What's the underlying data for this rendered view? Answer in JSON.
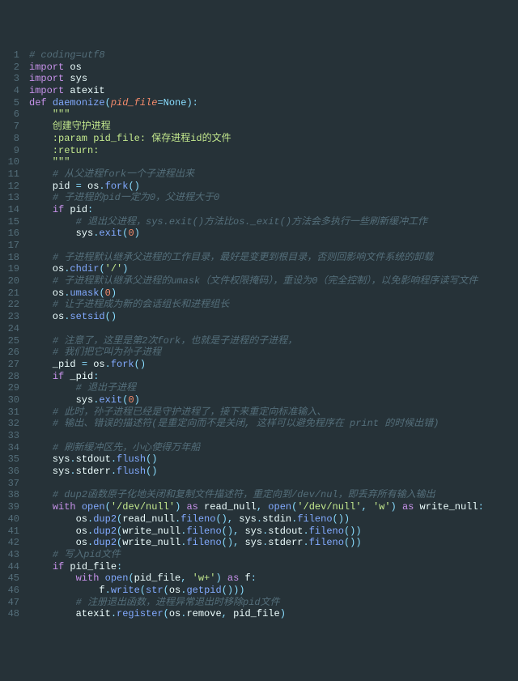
{
  "lines": [
    {
      "n": 1,
      "tokens": [
        [
          "com",
          "# coding=utf8"
        ]
      ]
    },
    {
      "n": 2,
      "tokens": [
        [
          "kw",
          "import"
        ],
        [
          "var",
          " os"
        ]
      ]
    },
    {
      "n": 3,
      "tokens": [
        [
          "kw",
          "import"
        ],
        [
          "var",
          " sys"
        ]
      ]
    },
    {
      "n": 4,
      "tokens": [
        [
          "kw",
          "import"
        ],
        [
          "var",
          " atexit"
        ]
      ]
    },
    {
      "n": 5,
      "tokens": [
        [
          "kw",
          "def "
        ],
        [
          "fn",
          "daemonize"
        ],
        [
          "op",
          "("
        ],
        [
          "param",
          "pid_file"
        ],
        [
          "op",
          "="
        ],
        [
          "kw2",
          "None"
        ],
        [
          "op",
          "):"
        ]
      ]
    },
    {
      "n": 6,
      "tokens": [
        [
          "var",
          "    "
        ],
        [
          "str",
          "\"\"\""
        ]
      ]
    },
    {
      "n": 7,
      "tokens": [
        [
          "str",
          "    创建守护进程"
        ]
      ]
    },
    {
      "n": 8,
      "tokens": [
        [
          "str",
          "    :param pid_file: 保存进程id的文件"
        ]
      ]
    },
    {
      "n": 9,
      "tokens": [
        [
          "str",
          "    :return:"
        ]
      ]
    },
    {
      "n": 10,
      "tokens": [
        [
          "str",
          "    \"\"\""
        ]
      ]
    },
    {
      "n": 11,
      "tokens": [
        [
          "var",
          "    "
        ],
        [
          "com",
          "# 从父进程fork一个子进程出来"
        ]
      ]
    },
    {
      "n": 12,
      "tokens": [
        [
          "var",
          "    pid "
        ],
        [
          "op",
          "= "
        ],
        [
          "var",
          "os"
        ],
        [
          "op",
          "."
        ],
        [
          "fn",
          "fork"
        ],
        [
          "op",
          "()"
        ]
      ]
    },
    {
      "n": 13,
      "tokens": [
        [
          "var",
          "    "
        ],
        [
          "com",
          "# 子进程的pid一定为0，父进程大于0"
        ]
      ]
    },
    {
      "n": 14,
      "tokens": [
        [
          "var",
          "    "
        ],
        [
          "kw",
          "if"
        ],
        [
          "var",
          " pid"
        ],
        [
          "op",
          ":"
        ]
      ]
    },
    {
      "n": 15,
      "tokens": [
        [
          "var",
          "        "
        ],
        [
          "com",
          "# 退出父进程，sys.exit()方法比os._exit()方法会多执行一些刷新缓冲工作"
        ]
      ]
    },
    {
      "n": 16,
      "tokens": [
        [
          "var",
          "        sys"
        ],
        [
          "op",
          "."
        ],
        [
          "fn",
          "exit"
        ],
        [
          "op",
          "("
        ],
        [
          "num",
          "0"
        ],
        [
          "op",
          ")"
        ]
      ]
    },
    {
      "n": 17,
      "tokens": [
        [
          "var",
          " "
        ]
      ]
    },
    {
      "n": 18,
      "tokens": [
        [
          "var",
          "    "
        ],
        [
          "com",
          "# 子进程默认继承父进程的工作目录，最好是变更到根目录，否则回影响文件系统的卸载"
        ]
      ]
    },
    {
      "n": 19,
      "tokens": [
        [
          "var",
          "    os"
        ],
        [
          "op",
          "."
        ],
        [
          "fn",
          "chdir"
        ],
        [
          "op",
          "("
        ],
        [
          "str",
          "'/'"
        ],
        [
          "op",
          ")"
        ]
      ]
    },
    {
      "n": 20,
      "tokens": [
        [
          "var",
          "    "
        ],
        [
          "com",
          "# 子进程默认继承父进程的umask（文件权限掩码），重设为0（完全控制），以免影响程序读写文件"
        ]
      ]
    },
    {
      "n": 21,
      "tokens": [
        [
          "var",
          "    os"
        ],
        [
          "op",
          "."
        ],
        [
          "fn",
          "umask"
        ],
        [
          "op",
          "("
        ],
        [
          "num",
          "0"
        ],
        [
          "op",
          ")"
        ]
      ]
    },
    {
      "n": 22,
      "tokens": [
        [
          "var",
          "    "
        ],
        [
          "com",
          "# 让子进程成为新的会话组长和进程组长"
        ]
      ]
    },
    {
      "n": 23,
      "tokens": [
        [
          "var",
          "    os"
        ],
        [
          "op",
          "."
        ],
        [
          "fn",
          "setsid"
        ],
        [
          "op",
          "()"
        ]
      ]
    },
    {
      "n": 24,
      "tokens": [
        [
          "var",
          " "
        ]
      ]
    },
    {
      "n": 25,
      "tokens": [
        [
          "var",
          "    "
        ],
        [
          "com",
          "# 注意了，这里是第2次fork，也就是子进程的子进程，"
        ]
      ]
    },
    {
      "n": 26,
      "tokens": [
        [
          "var",
          "    "
        ],
        [
          "com",
          "# 我们把它叫为孙子进程"
        ]
      ]
    },
    {
      "n": 27,
      "tokens": [
        [
          "var",
          "    _pid "
        ],
        [
          "op",
          "= "
        ],
        [
          "var",
          "os"
        ],
        [
          "op",
          "."
        ],
        [
          "fn",
          "fork"
        ],
        [
          "op",
          "()"
        ]
      ]
    },
    {
      "n": 28,
      "tokens": [
        [
          "var",
          "    "
        ],
        [
          "kw",
          "if"
        ],
        [
          "var",
          " _pid"
        ],
        [
          "op",
          ":"
        ]
      ]
    },
    {
      "n": 29,
      "tokens": [
        [
          "var",
          "        "
        ],
        [
          "com",
          "# 退出子进程"
        ]
      ]
    },
    {
      "n": 30,
      "tokens": [
        [
          "var",
          "        sys"
        ],
        [
          "op",
          "."
        ],
        [
          "fn",
          "exit"
        ],
        [
          "op",
          "("
        ],
        [
          "num",
          "0"
        ],
        [
          "op",
          ")"
        ]
      ]
    },
    {
      "n": 31,
      "tokens": [
        [
          "var",
          "    "
        ],
        [
          "com",
          "# 此时，孙子进程已经是守护进程了，接下来重定向标准输入、"
        ]
      ]
    },
    {
      "n": 32,
      "tokens": [
        [
          "var",
          "    "
        ],
        [
          "com",
          "# 输出、错误的描述符(是重定向而不是关闭, 这样可以避免程序在 print 的时候出错)"
        ]
      ]
    },
    {
      "n": 33,
      "tokens": [
        [
          "var",
          " "
        ]
      ]
    },
    {
      "n": 34,
      "tokens": [
        [
          "var",
          "    "
        ],
        [
          "com",
          "# 刷新缓冲区先，小心使得万年船"
        ]
      ]
    },
    {
      "n": 35,
      "tokens": [
        [
          "var",
          "    sys"
        ],
        [
          "op",
          "."
        ],
        [
          "var",
          "stdout"
        ],
        [
          "op",
          "."
        ],
        [
          "fn",
          "flush"
        ],
        [
          "op",
          "()"
        ]
      ]
    },
    {
      "n": 36,
      "tokens": [
        [
          "var",
          "    sys"
        ],
        [
          "op",
          "."
        ],
        [
          "var",
          "stderr"
        ],
        [
          "op",
          "."
        ],
        [
          "fn",
          "flush"
        ],
        [
          "op",
          "()"
        ]
      ]
    },
    {
      "n": 37,
      "tokens": [
        [
          "var",
          " "
        ]
      ]
    },
    {
      "n": 38,
      "tokens": [
        [
          "var",
          "    "
        ],
        [
          "com",
          "# dup2函数原子化地关闭和复制文件描述符，重定向到/dev/nul，即丢弃所有输入输出"
        ]
      ]
    },
    {
      "n": 39,
      "tokens": [
        [
          "var",
          "    "
        ],
        [
          "kw",
          "with"
        ],
        [
          "var",
          " "
        ],
        [
          "fn",
          "open"
        ],
        [
          "op",
          "("
        ],
        [
          "str",
          "'/dev/null'"
        ],
        [
          "op",
          ") "
        ],
        [
          "kw",
          "as"
        ],
        [
          "var",
          " read_null"
        ],
        [
          "op",
          ", "
        ],
        [
          "fn",
          "open"
        ],
        [
          "op",
          "("
        ],
        [
          "str",
          "'/dev/null'"
        ],
        [
          "op",
          ", "
        ],
        [
          "str",
          "'w'"
        ],
        [
          "op",
          ") "
        ],
        [
          "kw",
          "as"
        ],
        [
          "var",
          " write_null"
        ],
        [
          "op",
          ":"
        ]
      ]
    },
    {
      "n": 40,
      "tokens": [
        [
          "var",
          "        os"
        ],
        [
          "op",
          "."
        ],
        [
          "fn",
          "dup2"
        ],
        [
          "op",
          "("
        ],
        [
          "var",
          "read_null"
        ],
        [
          "op",
          "."
        ],
        [
          "fn",
          "fileno"
        ],
        [
          "op",
          "(), "
        ],
        [
          "var",
          "sys"
        ],
        [
          "op",
          "."
        ],
        [
          "var",
          "stdin"
        ],
        [
          "op",
          "."
        ],
        [
          "fn",
          "fileno"
        ],
        [
          "op",
          "())"
        ]
      ]
    },
    {
      "n": 41,
      "tokens": [
        [
          "var",
          "        os"
        ],
        [
          "op",
          "."
        ],
        [
          "fn",
          "dup2"
        ],
        [
          "op",
          "("
        ],
        [
          "var",
          "write_null"
        ],
        [
          "op",
          "."
        ],
        [
          "fn",
          "fileno"
        ],
        [
          "op",
          "(), "
        ],
        [
          "var",
          "sys"
        ],
        [
          "op",
          "."
        ],
        [
          "var",
          "stdout"
        ],
        [
          "op",
          "."
        ],
        [
          "fn",
          "fileno"
        ],
        [
          "op",
          "())"
        ]
      ]
    },
    {
      "n": 42,
      "tokens": [
        [
          "var",
          "        os"
        ],
        [
          "op",
          "."
        ],
        [
          "fn",
          "dup2"
        ],
        [
          "op",
          "("
        ],
        [
          "var",
          "write_null"
        ],
        [
          "op",
          "."
        ],
        [
          "fn",
          "fileno"
        ],
        [
          "op",
          "(), "
        ],
        [
          "var",
          "sys"
        ],
        [
          "op",
          "."
        ],
        [
          "var",
          "stderr"
        ],
        [
          "op",
          "."
        ],
        [
          "fn",
          "fileno"
        ],
        [
          "op",
          "())"
        ]
      ]
    },
    {
      "n": 43,
      "tokens": [
        [
          "var",
          "    "
        ],
        [
          "com",
          "# 写入pid文件"
        ]
      ]
    },
    {
      "n": 44,
      "tokens": [
        [
          "var",
          "    "
        ],
        [
          "kw",
          "if"
        ],
        [
          "var",
          " pid_file"
        ],
        [
          "op",
          ":"
        ]
      ]
    },
    {
      "n": 45,
      "tokens": [
        [
          "var",
          "        "
        ],
        [
          "kw",
          "with"
        ],
        [
          "var",
          " "
        ],
        [
          "fn",
          "open"
        ],
        [
          "op",
          "("
        ],
        [
          "var",
          "pid_file"
        ],
        [
          "op",
          ", "
        ],
        [
          "str",
          "'w+'"
        ],
        [
          "op",
          ") "
        ],
        [
          "kw",
          "as"
        ],
        [
          "var",
          " f"
        ],
        [
          "op",
          ":"
        ]
      ]
    },
    {
      "n": 46,
      "tokens": [
        [
          "var",
          "            f"
        ],
        [
          "op",
          "."
        ],
        [
          "fn",
          "write"
        ],
        [
          "op",
          "("
        ],
        [
          "fn",
          "str"
        ],
        [
          "op",
          "("
        ],
        [
          "var",
          "os"
        ],
        [
          "op",
          "."
        ],
        [
          "fn",
          "getpid"
        ],
        [
          "op",
          "()))"
        ]
      ]
    },
    {
      "n": 47,
      "tokens": [
        [
          "var",
          "        "
        ],
        [
          "com",
          "# 注册退出函数，进程异常退出时移除pid文件"
        ]
      ]
    },
    {
      "n": 48,
      "tokens": [
        [
          "var",
          "        atexit"
        ],
        [
          "op",
          "."
        ],
        [
          "fn",
          "register"
        ],
        [
          "op",
          "("
        ],
        [
          "var",
          "os"
        ],
        [
          "op",
          "."
        ],
        [
          "var",
          "remove"
        ],
        [
          "op",
          ", "
        ],
        [
          "var",
          "pid_file"
        ],
        [
          "op",
          ")"
        ]
      ]
    }
  ],
  "token_class_map": {
    "kw": "c-kw",
    "kw2": "c-kw2",
    "fn": "c-fn",
    "str": "c-str",
    "com": "c-com",
    "num": "c-num",
    "op": "c-op",
    "var": "c-var",
    "param": "c-param",
    "self": "c-self"
  }
}
